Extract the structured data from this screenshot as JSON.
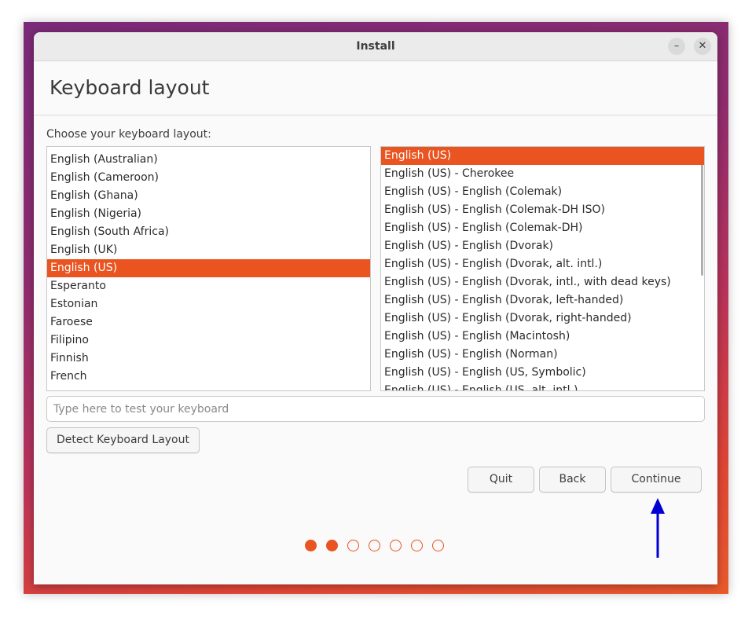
{
  "window": {
    "title": "Install",
    "minimize_glyph": "–",
    "close_glyph": "✕"
  },
  "page": {
    "title": "Keyboard layout",
    "prompt": "Choose your keyboard layout:"
  },
  "layouts": {
    "items": [
      "English (Australian)",
      "English (Cameroon)",
      "English (Ghana)",
      "English (Nigeria)",
      "English (South Africa)",
      "English (UK)",
      "English (US)",
      "Esperanto",
      "Estonian",
      "Faroese",
      "Filipino",
      "Finnish",
      "French"
    ],
    "selected": "English (US)"
  },
  "variants": {
    "items": [
      "English (US)",
      "English (US) - Cherokee",
      "English (US) - English (Colemak)",
      "English (US) - English (Colemak-DH ISO)",
      "English (US) - English (Colemak-DH)",
      "English (US) - English (Dvorak)",
      "English (US) - English (Dvorak, alt. intl.)",
      "English (US) - English (Dvorak, intl., with dead keys)",
      "English (US) - English (Dvorak, left-handed)",
      "English (US) - English (Dvorak, right-handed)",
      "English (US) - English (Macintosh)",
      "English (US) - English (Norman)",
      "English (US) - English (US, Symbolic)",
      "English (US) - English (US, alt. intl.)"
    ],
    "selected": "English (US)"
  },
  "test_input": {
    "placeholder": "Type here to test your keyboard",
    "value": ""
  },
  "buttons": {
    "detect": "Detect Keyboard Layout",
    "quit": "Quit",
    "back": "Back",
    "continue": "Continue"
  },
  "progress": {
    "current_step": 2,
    "total_steps": 7
  },
  "colors": {
    "accent": "#e95420",
    "annotation_arrow": "#0000d4"
  }
}
